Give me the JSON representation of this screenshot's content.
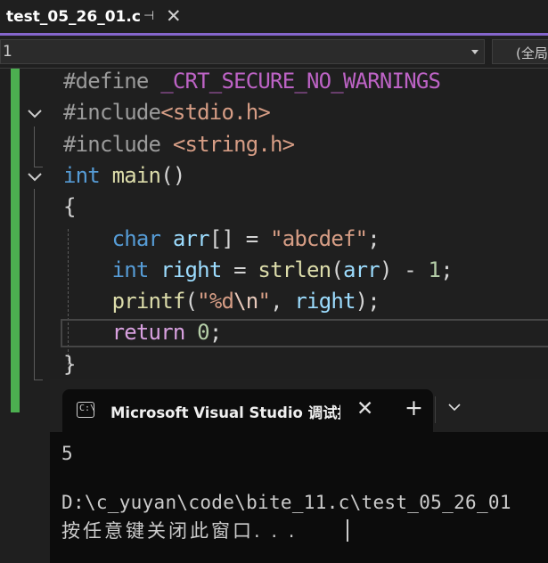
{
  "tab": {
    "title": "test_05_26_01.c",
    "pin_glyph": "⊣",
    "close_glyph": "✕"
  },
  "navbar": {
    "scope_value": "1",
    "member_value": "(全局"
  },
  "code": [
    {
      "tokens": [
        {
          "t": "#define ",
          "c": "pp"
        },
        {
          "t": "_CRT_SECURE_NO_WARNINGS",
          "c": "mac"
        }
      ]
    },
    {
      "tokens": [
        {
          "t": "#include",
          "c": "pp"
        },
        {
          "t": "<stdio.h>",
          "c": "str"
        }
      ]
    },
    {
      "tokens": [
        {
          "t": "#include ",
          "c": "pp"
        },
        {
          "t": "<string.h>",
          "c": "str"
        }
      ]
    },
    {
      "tokens": [
        {
          "t": "int",
          "c": "kw"
        },
        {
          "t": " "
        },
        {
          "t": "main",
          "c": "fn"
        },
        {
          "t": "()"
        }
      ]
    },
    {
      "tokens": [
        {
          "t": "{"
        }
      ]
    },
    {
      "tokens": [
        {
          "t": "    "
        },
        {
          "t": "char",
          "c": "kw"
        },
        {
          "t": " "
        },
        {
          "t": "arr",
          "c": "var"
        },
        {
          "t": "[] = "
        },
        {
          "t": "\"abcdef\"",
          "c": "str"
        },
        {
          "t": ";"
        }
      ]
    },
    {
      "tokens": [
        {
          "t": "    "
        },
        {
          "t": "int",
          "c": "kw"
        },
        {
          "t": " "
        },
        {
          "t": "right",
          "c": "var"
        },
        {
          "t": " = "
        },
        {
          "t": "strlen",
          "c": "fn"
        },
        {
          "t": "("
        },
        {
          "t": "arr",
          "c": "var"
        },
        {
          "t": ") - "
        },
        {
          "t": "1",
          "c": "num"
        },
        {
          "t": ";"
        }
      ]
    },
    {
      "tokens": [
        {
          "t": "    "
        },
        {
          "t": "printf",
          "c": "fn"
        },
        {
          "t": "("
        },
        {
          "t": "\"%d",
          "c": "str"
        },
        {
          "t": "\\n",
          "c": "esc"
        },
        {
          "t": "\"",
          "c": "str"
        },
        {
          "t": ", "
        },
        {
          "t": "right",
          "c": "var"
        },
        {
          "t": ");"
        }
      ]
    },
    {
      "tokens": [
        {
          "t": "    "
        },
        {
          "t": "return",
          "c": "ret"
        },
        {
          "t": " "
        },
        {
          "t": "0",
          "c": "num"
        },
        {
          "t": ";"
        }
      ]
    },
    {
      "tokens": [
        {
          "t": "}"
        }
      ]
    }
  ],
  "console": {
    "title": "Microsoft Visual Studio 调试控制台",
    "icon_label": "C:\\",
    "close_glyph": "✕",
    "new_tab_glyph": "+",
    "output_line1": "5",
    "output_line2": "D:\\c_yuyan\\code\\bite_11.c\\test_05_26_01",
    "prompt": "按任意键关闭此窗口. . ."
  }
}
